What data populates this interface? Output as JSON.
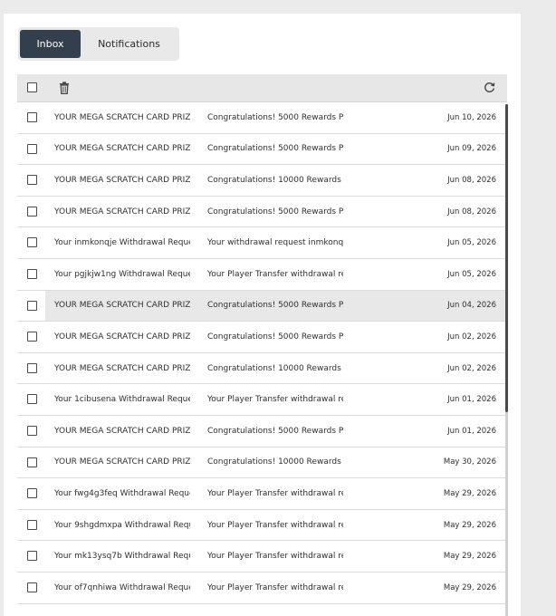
{
  "tabs": [
    {
      "label": "Inbox",
      "active": true
    },
    {
      "label": "Notifications",
      "active": false
    }
  ],
  "toolbar": {
    "select_all_icon": "checkbox-icon",
    "delete_icon": "trash-icon",
    "refresh_icon": "refresh-icon"
  },
  "messages": [
    {
      "subject": "YOUR MEGA SCRATCH CARD PRIZ...",
      "preview": "Congratulations! 5000 Rewards P...",
      "date": "Jun 10, 2026"
    },
    {
      "subject": "YOUR MEGA SCRATCH CARD PRIZ...",
      "preview": "Congratulations! 5000 Rewards P...",
      "date": "Jun 09, 2026"
    },
    {
      "subject": "YOUR MEGA SCRATCH CARD PRIZ...",
      "preview": "Congratulations! 10000 Rewards P...",
      "date": "Jun 08, 2026"
    },
    {
      "subject": "YOUR MEGA SCRATCH CARD PRIZ...",
      "preview": "Congratulations! 5000 Rewards P...",
      "date": "Jun 08, 2026"
    },
    {
      "subject": "Your inmkonqje Withdrawal Request",
      "preview": "Your withdrawal request inmkonqj...",
      "date": "Jun 05, 2026"
    },
    {
      "subject": "Your pgjkjw1ng Withdrawal Request",
      "preview": "Your Player Transfer withdrawal re...",
      "date": "Jun 05, 2026"
    },
    {
      "subject": "YOUR MEGA SCRATCH CARD PRIZ...",
      "preview": "Congratulations! 5000 Rewards P...",
      "date": "Jun 04, 2026",
      "highlighted": true
    },
    {
      "subject": "YOUR MEGA SCRATCH CARD PRIZ...",
      "preview": "Congratulations! 5000 Rewards P...",
      "date": "Jun 02, 2026"
    },
    {
      "subject": "YOUR MEGA SCRATCH CARD PRIZ...",
      "preview": "Congratulations! 10000 Rewards P...",
      "date": "Jun 02, 2026"
    },
    {
      "subject": "Your 1cibusena Withdrawal Request",
      "preview": "Your Player Transfer withdrawal re...",
      "date": "Jun 01, 2026"
    },
    {
      "subject": "YOUR MEGA SCRATCH CARD PRIZ...",
      "preview": "Congratulations! 5000 Rewards P...",
      "date": "Jun 01, 2026"
    },
    {
      "subject": "YOUR MEGA SCRATCH CARD PRIZ...",
      "preview": "Congratulations! 10000 Rewards P...",
      "date": "May 30, 2026"
    },
    {
      "subject": "Your fwg4g3feq Withdrawal Reque...",
      "preview": "Your Player Transfer withdrawal re...",
      "date": "May 29, 2026"
    },
    {
      "subject": "Your 9shgdmxpa Withdrawal Requ...",
      "preview": "Your Player Transfer withdrawal re...",
      "date": "May 29, 2026"
    },
    {
      "subject": "Your mk13ysq7b Withdrawal Reque...",
      "preview": "Your Player Transfer withdrawal re...",
      "date": "May 29, 2026"
    },
    {
      "subject": "Your of7qnhiwa Withdrawal Request",
      "preview": "Your Player Transfer withdrawal re...",
      "date": "May 29, 2026"
    }
  ],
  "colors": {
    "active_tab": "#343f4d",
    "highlight_row": "#e8e8e8",
    "toolbar_bg": "#e7e7e7"
  }
}
